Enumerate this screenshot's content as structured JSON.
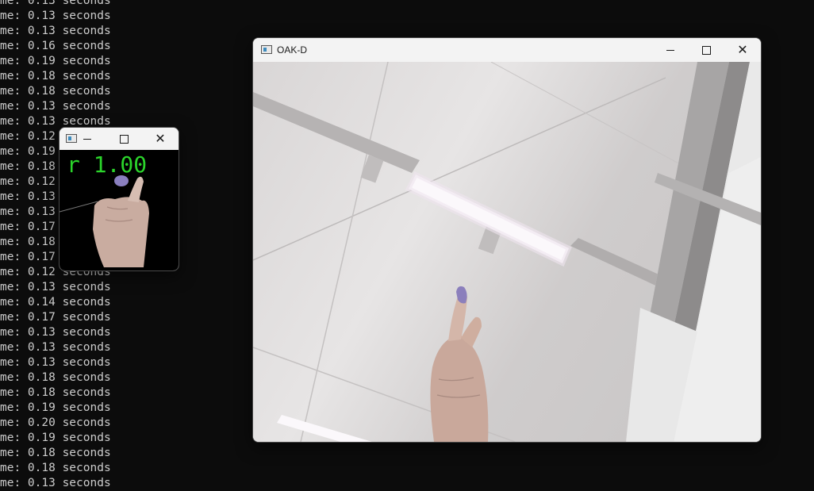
{
  "terminal": {
    "lines": [
      "me: 0.13 seconds",
      "me: 0.13 seconds",
      "me: 0.13 seconds",
      "me: 0.16 seconds",
      "me: 0.19 seconds",
      "me: 0.18 seconds",
      "me: 0.18 seconds",
      "me: 0.13 seconds",
      "me: 0.13 seconds",
      "me: 0.12 seconds",
      "me: 0.19 seconds",
      "me: 0.18 seconds",
      "me: 0.12 seconds",
      "me: 0.13 seconds",
      "me: 0.13 seconds",
      "me: 0.17 seconds",
      "me: 0.18 seconds",
      "me: 0.17 seconds",
      "me: 0.12 seconds",
      "me: 0.13 seconds",
      "me: 0.14 seconds",
      "me: 0.17 seconds",
      "me: 0.13 seconds",
      "me: 0.13 seconds",
      "me: 0.13 seconds",
      "me: 0.18 seconds",
      "me: 0.18 seconds",
      "me: 0.19 seconds",
      "me: 0.20 seconds",
      "me: 0.19 seconds",
      "me: 0.18 seconds",
      "me: 0.18 seconds",
      "me: 0.13 seconds"
    ]
  },
  "small_window": {
    "title": "",
    "overlay_text": "r 1.00",
    "overlay_color": "#2bd52b"
  },
  "oak_window": {
    "title": "OAK-D"
  },
  "icons": {
    "minimize": "minimize-icon",
    "maximize": "maximize-icon",
    "close": "close-icon",
    "app": "app-window-icon"
  }
}
